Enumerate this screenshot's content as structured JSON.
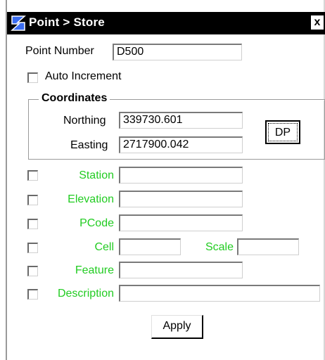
{
  "window": {
    "title": "Point > Store",
    "close_label": "x"
  },
  "form": {
    "point_number_label": "Point Number",
    "point_number_value": "D500",
    "auto_increment_label": "Auto Increment",
    "coordinates_title": "Coordinates",
    "northing_label": "Northing",
    "northing_value": "339730.601",
    "easting_label": "Easting",
    "easting_value": "2717900.042",
    "dp_label": "DP",
    "station_label": "Station",
    "elevation_label": "Elevation",
    "pcode_label": "PCode",
    "cell_label": "Cell",
    "scale_label": "Scale",
    "feature_label": "Feature",
    "description_label": "Description",
    "apply_label": "Apply"
  },
  "colors": {
    "label_green": "#22cc22",
    "titlebar": "#000000"
  },
  "icons": {
    "app_logo": "inroads-logo-icon",
    "close": "close-icon"
  }
}
